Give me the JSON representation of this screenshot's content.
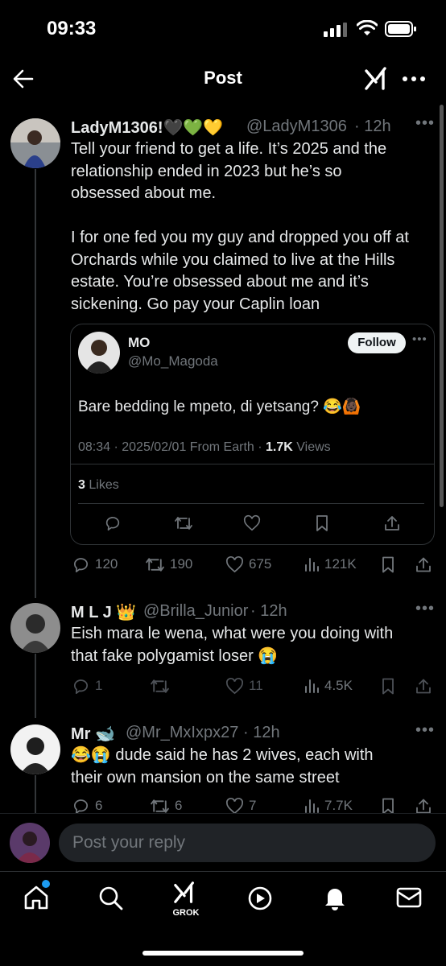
{
  "status_bar": {
    "time": "09:33"
  },
  "header": {
    "title": "Post"
  },
  "main_post": {
    "display_name": "LadyM1306!🖤💚💛",
    "handle": "@LadyM1306",
    "time": "· 12h",
    "body_lines": [
      "Tell your friend to get a life. It’s 2025 and the",
      "relationship ended in 2023 but he’s so",
      "obsessed about me."
    ],
    "body_lines_2": [
      "I for one fed you my guy and dropped you off at",
      "Orchards while you claimed to live at the Hills",
      "estate. You’re obsessed about me and it’s",
      "sickening. Go pay your Caplin loan"
    ],
    "stats": {
      "replies": "120",
      "reposts": "190",
      "likes": "675",
      "views": "121K"
    }
  },
  "quoted_post": {
    "display_name": "MO",
    "handle": "@Mo_Magoda",
    "follow_label": "Follow",
    "body": "Bare bedding le mpeto, di yetsang? 😂🙆🏿",
    "meta_time": "08:34 · 2025/02/01 From Earth ·",
    "meta_views_num": "1.7K",
    "meta_views_label": "Views",
    "likes_num": "3",
    "likes_label": "Likes"
  },
  "replies": [
    {
      "display_name": "M L J 👑",
      "handle": "@Brilla_Junior",
      "time": "· 12h",
      "body_lines": [
        "Eish mara le wena, what were you doing with",
        "that fake polygamist loser 😭"
      ],
      "stats": {
        "replies": "1",
        "reposts": "",
        "likes": "11",
        "views": "4.5K"
      }
    },
    {
      "display_name": "Mr 🐋",
      "handle": "@Mr_MxIxpx27",
      "time": "· 12h",
      "body_lines": [
        "😂😭 dude said he has 2 wives, each with",
        "their own mansion on the same street"
      ],
      "stats": {
        "replies": "6",
        "reposts": "6",
        "likes": "7",
        "views": "7.7K"
      }
    }
  ],
  "reply_box": {
    "placeholder": "Post your reply"
  },
  "tab_bar": {
    "grok_label": "GROK"
  },
  "colors": {
    "background": "#000000",
    "text": "#e7e9ea",
    "muted": "#71767b",
    "accent": "#1d9bf0",
    "border": "#2f3336"
  }
}
